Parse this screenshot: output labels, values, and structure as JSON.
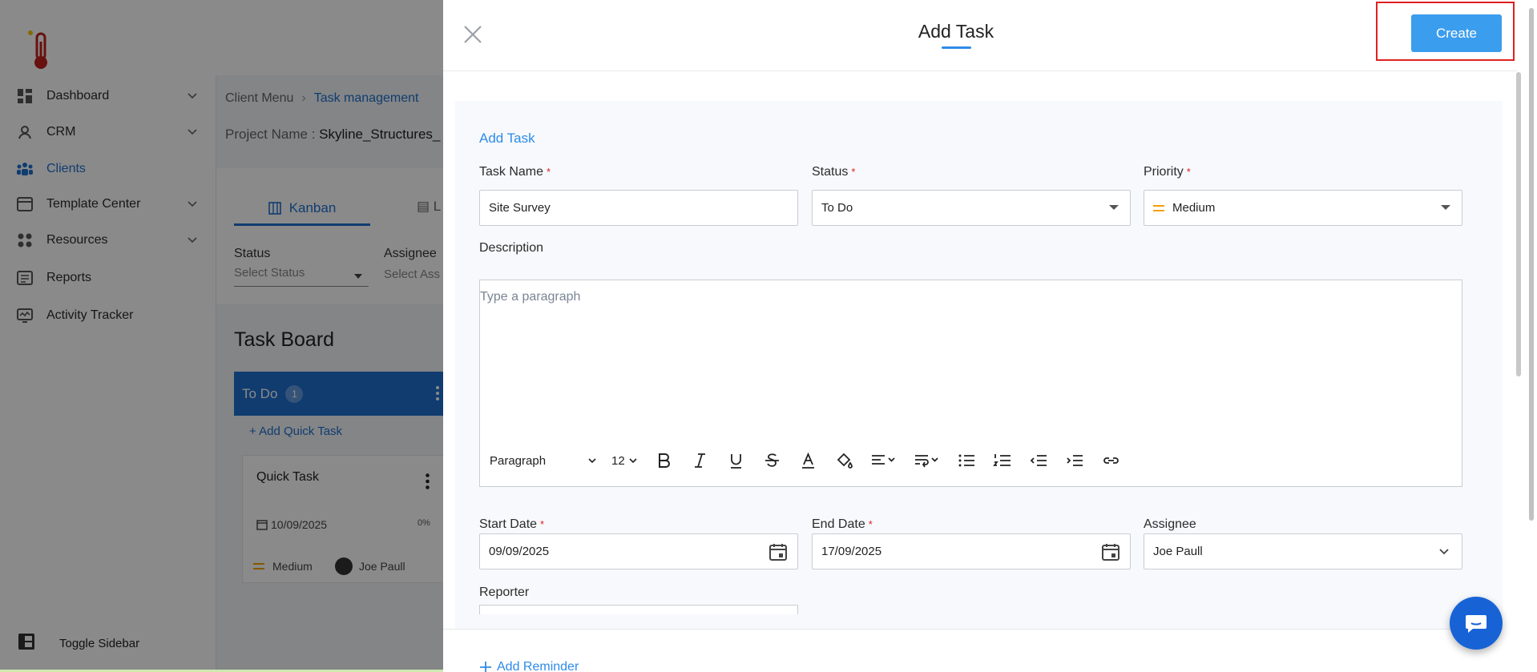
{
  "sidebar": {
    "items": [
      {
        "label": "Dashboard",
        "icon": "dashboard-icon",
        "expandable": true
      },
      {
        "label": "CRM",
        "icon": "crm-icon",
        "expandable": true
      },
      {
        "label": "Clients",
        "icon": "clients-icon",
        "expandable": false,
        "active": true
      },
      {
        "label": "Template Center",
        "icon": "template-icon",
        "expandable": true
      },
      {
        "label": "Resources",
        "icon": "resources-icon",
        "expandable": true
      },
      {
        "label": "Reports",
        "icon": "reports-icon",
        "expandable": false
      },
      {
        "label": "Activity Tracker",
        "icon": "activity-icon",
        "expandable": false
      }
    ],
    "toggle_label": "Toggle Sidebar"
  },
  "background": {
    "breadcrumb": {
      "root": "Client Menu",
      "current": "Task management"
    },
    "project_label": "Project Name :",
    "project_value": "Skyline_Structures_",
    "tab_kanban": "Kanban",
    "tab_list": "L",
    "filter_status_label": "Status",
    "filter_status_placeholder": "Select Status",
    "filter_assignee_label": "Assignee",
    "filter_assignee_placeholder": "Select Ass",
    "board_title": "Task Board",
    "column_todo": "To Do",
    "column_todo_count": "1",
    "add_quick_task": "+ Add Quick Task",
    "card": {
      "title": "Quick Task",
      "date": "10/09/2025",
      "progress": "0%",
      "priority": "Medium",
      "assignee": "Joe Paull"
    }
  },
  "drawer": {
    "title": "Add Task",
    "create_label": "Create",
    "section_title": "Add Task",
    "task_name": {
      "label": "Task Name",
      "value": "Site Survey"
    },
    "status": {
      "label": "Status",
      "value": "To Do"
    },
    "priority": {
      "label": "Priority",
      "value": "Medium"
    },
    "description": {
      "label": "Description",
      "placeholder": "Type a paragraph"
    },
    "toolbar": {
      "paragraph": "Paragraph",
      "font_size": "12"
    },
    "start_date": {
      "label": "Start Date",
      "value": "09/09/2025"
    },
    "end_date": {
      "label": "End Date",
      "value": "17/09/2025"
    },
    "assignee": {
      "label": "Assignee",
      "value": "Joe Paull"
    },
    "reporter": {
      "label": "Reporter"
    },
    "add_reminder": "Add Reminder"
  },
  "colors": {
    "accent": "#2e8be8",
    "create_button": "#3b9ded",
    "required": "#e02020",
    "priority_medium": "#f5a000",
    "highlight": "#e02020"
  }
}
